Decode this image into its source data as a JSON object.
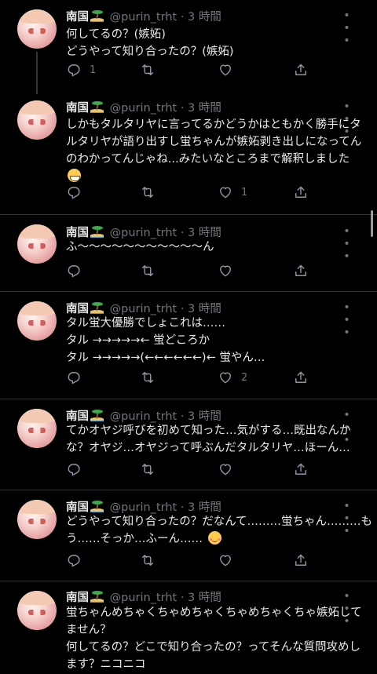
{
  "colors": {
    "background": "#000000",
    "text": "#e7e9ea",
    "secondary": "#71767b",
    "divider": "#2f3336"
  },
  "tweets": [
    {
      "name": "南国",
      "handle": "@purin_trht",
      "time": "· 3 時間",
      "more": "• • •",
      "lines": [
        "何してるの？(嫉妬)",
        "どうやって知り合ったの？(嫉妬)"
      ],
      "reply_count": "1",
      "retweet_count": "",
      "like_count": "",
      "thread": true
    },
    {
      "name": "南国",
      "handle": "@purin_trht",
      "time": "· 3 時間",
      "more": "• • •",
      "lines": [
        "しかもタルタリヤに言ってるかどうかはともかく勝手にタ",
        "ルタリヤが語り出すし蛍ちゃんが嫉妬剥き出しになってん",
        "のわかってんじゃね...みたいなところまで解釈しました"
      ],
      "emoji": "grinning-face",
      "reply_count": "",
      "retweet_count": "",
      "like_count": "1"
    },
    {
      "name": "南国",
      "handle": "@purin_trht",
      "time": "· 3 時間",
      "more": "• • •",
      "lines": [
        "ふ〜〜〜〜〜〜〜〜〜〜〜ん"
      ],
      "reply_count": "",
      "retweet_count": "",
      "like_count": ""
    },
    {
      "name": "南国",
      "handle": "@purin_trht",
      "time": "· 3 時間",
      "more": "• • •",
      "lines": [
        "タル蛍大優勝でしょこれは……",
        "タル →→→→→← 蛍どころか",
        "タル →→→→→(←←←←←←)← 蛍やん…"
      ],
      "reply_count": "",
      "retweet_count": "",
      "like_count": "2"
    },
    {
      "name": "南国",
      "handle": "@purin_trht",
      "time": "· 3 時間",
      "more": "• • •",
      "lines": [
        "てかオヤジ呼びを初めて知った…気がする…既出なんか",
        "な？オヤジ…オヤジって呼ぶんだタルタリヤ…ほーん…"
      ],
      "reply_count": "",
      "retweet_count": "",
      "like_count": ""
    },
    {
      "name": "南国",
      "handle": "@purin_trht",
      "time": "· 3 時間",
      "more": "• • •",
      "lines": [
        "どうやって知り合ったの？だなんて………蛍ちゃん………も",
        "う……そっか…ふーん……"
      ],
      "emoji": "relieved-face",
      "reply_count": "",
      "retweet_count": "",
      "like_count": ""
    },
    {
      "name": "南国",
      "handle": "@purin_trht",
      "time": "· 3 時間",
      "more": "• • •",
      "lines": [
        "蛍ちゃんめちゃくちゃめちゃくちゃめちゃくちゃ嫉妬して",
        "ません？",
        "何してるの？どこで知り合ったの？ってそんな質問攻めし",
        "ます？ニコニコ"
      ]
    }
  ]
}
